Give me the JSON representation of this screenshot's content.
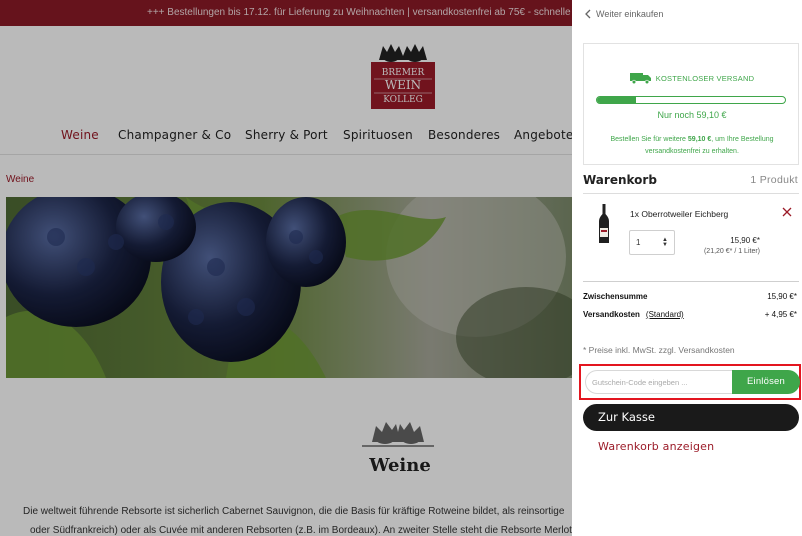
{
  "banner": {
    "text": "+++ Bestellungen bis 17.12. für Lieferung zu Weihnachten | versandkostenfrei ab 75€ - schnelle & si"
  },
  "logo": {
    "line1": "BREMER",
    "line2": "WEIN",
    "line3": "KOLLEG"
  },
  "nav": {
    "items": [
      {
        "label": "Weine",
        "active": true
      },
      {
        "label": "Champagner & Co"
      },
      {
        "label": "Sherry & Port"
      },
      {
        "label": "Spirituosen"
      },
      {
        "label": "Besonderes"
      },
      {
        "label": "Angebote"
      }
    ]
  },
  "breadcrumb": "Weine",
  "main": {
    "title": "Weine",
    "intro_line1": "Die weltweit führende Rebsorte ist sicherlich Cabernet Sauvignon, die die Basis für kräftige Rotweine bildet, als reinsortige",
    "intro_line2": "oder Südfrankreich) oder als Cuvée mit anderen Rebsorten (z.B. im Bordeaux). An zweiter Stelle steht die Rebsorte Merlot"
  },
  "cart": {
    "back_label": "Weiter einkaufen",
    "shipping": {
      "headline": "KOSTENLOSER VERSAND",
      "progress_percent": 21,
      "remaining": "Nur noch 59,10 €",
      "note_pre": "Bestellen Sie für weitere",
      "note_amount": "59,10 €",
      "note_post": ", um Ihre Bestellung versandkostenfrei zu erhalten."
    },
    "title": "Warenkorb",
    "count": "1 Produkt",
    "item": {
      "name": "1x Oberrotweiler Eichberg",
      "quantity": "1",
      "price": "15,90 €*",
      "unit_price": "(21,20 €* / 1 Liter)"
    },
    "subtotal_label": "Zwischensumme",
    "subtotal": "15,90 €*",
    "shipping_label": "Versandkosten",
    "shipping_method": "(Standard)",
    "shipping_cost": "+ 4,95 €*",
    "vat_note": "* Preise inkl. MwSt. zzgl. Versandkosten",
    "voucher_placeholder": "Gutschein-Code eingeben ...",
    "voucher_button": "Einlösen",
    "checkout_button": "Zur Kasse",
    "view_cart_link": "Warenkorb anzeigen"
  },
  "colors": {
    "brand_red": "#9b1b28",
    "green": "#3fa64a",
    "highlight": "#e3151f"
  }
}
